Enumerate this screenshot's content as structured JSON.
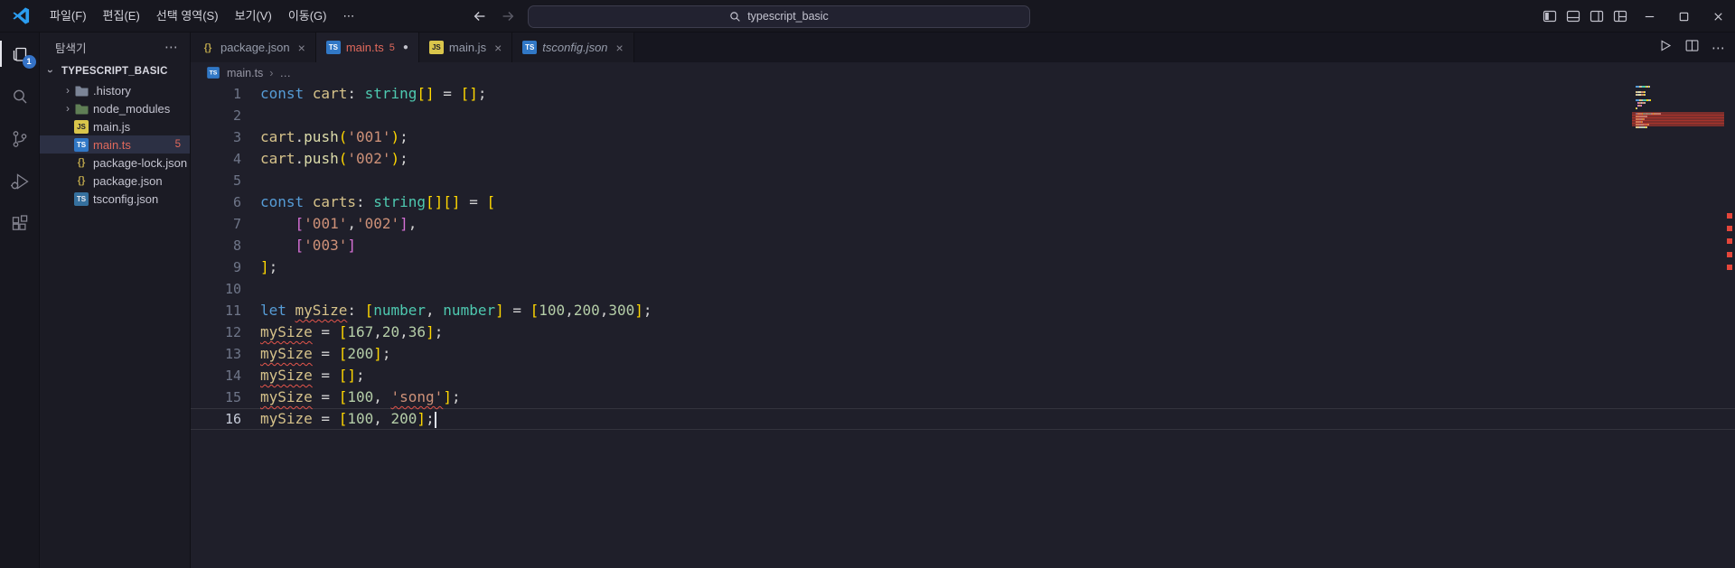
{
  "titlebar": {
    "menus": [
      "파일(F)",
      "편집(E)",
      "선택 영역(S)",
      "보기(V)",
      "이동(G)"
    ],
    "search": {
      "value": "typescript_basic"
    },
    "layout_icons": [
      "toggle-sidebar-left",
      "toggle-panel-bottom",
      "toggle-sidebar-right",
      "customize-layout"
    ],
    "window_controls": [
      "minimize",
      "maximize",
      "close"
    ]
  },
  "icons": {
    "chevron": "›",
    "more": "⋯",
    "dirty": "●",
    "close": "×"
  },
  "activity_bar": {
    "badge": "1",
    "items": [
      "explorer",
      "search",
      "source-control",
      "run-and-debug",
      "extensions"
    ]
  },
  "sidebar": {
    "title": "탐색기",
    "root": "TYPESCRIPT_BASIC",
    "items": [
      {
        "label": ".history",
        "kind": "folder",
        "icon": "folder"
      },
      {
        "label": "node_modules",
        "kind": "folder",
        "icon": "folder-green"
      },
      {
        "label": "main.js",
        "kind": "file",
        "icon": "js"
      },
      {
        "label": "main.ts",
        "kind": "file",
        "icon": "ts",
        "selected": true,
        "error": true,
        "badge": "5"
      },
      {
        "label": "package-lock.json",
        "kind": "file",
        "icon": "json"
      },
      {
        "label": "package.json",
        "kind": "file",
        "icon": "json"
      },
      {
        "label": "tsconfig.json",
        "kind": "file",
        "icon": "tsconfig"
      }
    ]
  },
  "tabs": [
    {
      "label": "package.json",
      "icon": "json",
      "close": true
    },
    {
      "label": "main.ts",
      "icon": "ts",
      "active": true,
      "error": true,
      "badge": "5",
      "dirty": true
    },
    {
      "label": "main.js",
      "icon": "js",
      "close": true
    },
    {
      "label": "tsconfig.json",
      "icon": "ts",
      "italic": true,
      "close": true
    }
  ],
  "breadcrumb": {
    "file": "main.ts",
    "separator": "›",
    "more": "…"
  },
  "code": {
    "cursor_line": 16,
    "current_line": 16,
    "error_lines": [
      11,
      12,
      13,
      14,
      15
    ],
    "lines": [
      {
        "n": 1,
        "t": [
          [
            "kw",
            "const "
          ],
          [
            "v",
            "cart"
          ],
          [
            "p",
            ": "
          ],
          [
            "t",
            "string"
          ],
          [
            "b1",
            "[]"
          ],
          [
            "p",
            " = "
          ],
          [
            "b1",
            "[]"
          ],
          [
            "p",
            ";"
          ]
        ]
      },
      {
        "n": 2,
        "t": []
      },
      {
        "n": 3,
        "t": [
          [
            "v",
            "cart"
          ],
          [
            "p",
            "."
          ],
          [
            "m",
            "push"
          ],
          [
            "b1",
            "("
          ],
          [
            "s",
            "'001'"
          ],
          [
            "b1",
            ")"
          ],
          [
            "p",
            ";"
          ]
        ]
      },
      {
        "n": 4,
        "t": [
          [
            "v",
            "cart"
          ],
          [
            "p",
            "."
          ],
          [
            "m",
            "push"
          ],
          [
            "b1",
            "("
          ],
          [
            "s",
            "'002'"
          ],
          [
            "b1",
            ")"
          ],
          [
            "p",
            ";"
          ]
        ]
      },
      {
        "n": 5,
        "t": []
      },
      {
        "n": 6,
        "t": [
          [
            "kw",
            "const "
          ],
          [
            "v",
            "carts"
          ],
          [
            "p",
            ": "
          ],
          [
            "t",
            "string"
          ],
          [
            "b1",
            "[][]"
          ],
          [
            "p",
            " = "
          ],
          [
            "b1",
            "["
          ]
        ]
      },
      {
        "n": 7,
        "t": [
          [
            "p",
            "    "
          ],
          [
            "b2",
            "["
          ],
          [
            "s",
            "'001'"
          ],
          [
            "p",
            ","
          ],
          [
            "s",
            "'002'"
          ],
          [
            "b2",
            "]"
          ],
          [
            "p",
            ","
          ]
        ]
      },
      {
        "n": 8,
        "t": [
          [
            "p",
            "    "
          ],
          [
            "b2",
            "["
          ],
          [
            "s",
            "'003'"
          ],
          [
            "b2",
            "]"
          ]
        ]
      },
      {
        "n": 9,
        "t": [
          [
            "b1",
            "]"
          ],
          [
            "p",
            ";"
          ]
        ]
      },
      {
        "n": 10,
        "t": []
      },
      {
        "n": 11,
        "t": [
          [
            "kw",
            "let "
          ],
          [
            "ve",
            "mySize"
          ],
          [
            "p",
            ": "
          ],
          [
            "b1",
            "["
          ],
          [
            "t",
            "number"
          ],
          [
            "p",
            ", "
          ],
          [
            "t",
            "number"
          ],
          [
            "b1",
            "]"
          ],
          [
            "p",
            " = "
          ],
          [
            "b1",
            "["
          ],
          [
            "n",
            "100"
          ],
          [
            "p",
            ","
          ],
          [
            "n",
            "200"
          ],
          [
            "p",
            ","
          ],
          [
            "n",
            "300"
          ],
          [
            "b1",
            "]"
          ],
          [
            "p",
            ";"
          ]
        ]
      },
      {
        "n": 12,
        "t": [
          [
            "ve",
            "mySize"
          ],
          [
            "p",
            " = "
          ],
          [
            "b1",
            "["
          ],
          [
            "n",
            "167"
          ],
          [
            "p",
            ","
          ],
          [
            "n",
            "20"
          ],
          [
            "p",
            ","
          ],
          [
            "n",
            "36"
          ],
          [
            "b1",
            "]"
          ],
          [
            "p",
            ";"
          ]
        ]
      },
      {
        "n": 13,
        "t": [
          [
            "ve",
            "mySize"
          ],
          [
            "p",
            " = "
          ],
          [
            "b1",
            "["
          ],
          [
            "n",
            "200"
          ],
          [
            "b1",
            "]"
          ],
          [
            "p",
            ";"
          ]
        ]
      },
      {
        "n": 14,
        "t": [
          [
            "ve",
            "mySize"
          ],
          [
            "p",
            " = "
          ],
          [
            "b1",
            "[]"
          ],
          [
            "p",
            ";"
          ]
        ]
      },
      {
        "n": 15,
        "t": [
          [
            "ve",
            "mySize"
          ],
          [
            "p",
            " = "
          ],
          [
            "b1",
            "["
          ],
          [
            "n",
            "100"
          ],
          [
            "p",
            ", "
          ],
          [
            "se",
            "'song'"
          ],
          [
            "b1",
            "]"
          ],
          [
            "p",
            ";"
          ]
        ]
      },
      {
        "n": 16,
        "t": [
          [
            "v",
            "mySize"
          ],
          [
            "p",
            " = "
          ],
          [
            "b1",
            "["
          ],
          [
            "n",
            "100"
          ],
          [
            "p",
            ", "
          ],
          [
            "n",
            "200"
          ],
          [
            "b1",
            "]"
          ],
          [
            "p",
            ";"
          ]
        ]
      }
    ]
  },
  "colors": {
    "accent_blue": "#3573c7",
    "error": "#e0695c",
    "squiggle": "#e4554b",
    "syntax": {
      "kw": "#569cd6",
      "v": "#d6c28a",
      "t": "#4ec9b0",
      "m": "#dcdcaa",
      "s": "#ce9178",
      "n": "#b5cea8",
      "p": "#b9b9c2",
      "b1": "#ffd700",
      "b2": "#d670d6"
    }
  }
}
